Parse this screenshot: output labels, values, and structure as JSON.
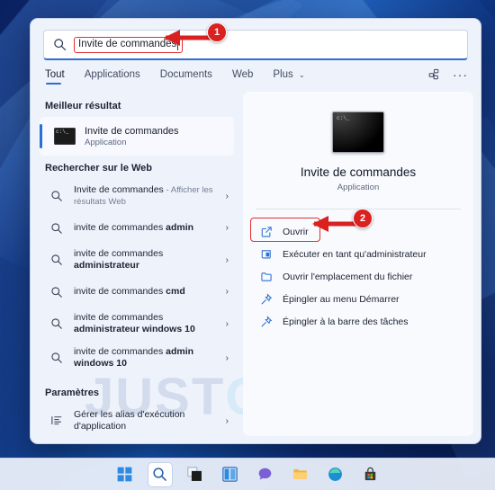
{
  "search": {
    "query": "Invite de commandes",
    "icon": "search-icon"
  },
  "tabs": [
    {
      "label": "Tout",
      "active": true
    },
    {
      "label": "Applications",
      "active": false
    },
    {
      "label": "Documents",
      "active": false
    },
    {
      "label": "Web",
      "active": false
    },
    {
      "label": "Plus",
      "active": false,
      "chevron": "⌄"
    }
  ],
  "tabs_right": {
    "share_icon": "share-nodes-icon",
    "more_icon": "more-options-icon",
    "more_glyph": "···"
  },
  "left": {
    "best_section_title": "Meilleur résultat",
    "best_result": {
      "title": "Invite de commandes",
      "subtitle": "Application",
      "icon_text": "c:\\_"
    },
    "web_section_title": "Rechercher sur le Web",
    "web_results": [
      {
        "main": "Invite de commandes",
        "suffix": " - Afficher les résultats Web",
        "bold": "",
        "two_line": true
      },
      {
        "main": "invite de commandes ",
        "bold": "admin",
        "suffix": "",
        "two_line": false
      },
      {
        "main": "invite de commandes ",
        "bold": "administrateur",
        "suffix": "",
        "two_line": true
      },
      {
        "main": "invite de commandes ",
        "bold": "cmd",
        "suffix": "",
        "two_line": false
      },
      {
        "main": "invite de commandes ",
        "bold": "administrateur windows 10",
        "suffix": "",
        "two_line": true
      },
      {
        "main": "invite de commandes ",
        "bold": "admin windows 10",
        "suffix": "",
        "two_line": true
      }
    ],
    "settings_section_title": "Paramètres",
    "settings_items": [
      {
        "label": "Gérer les alias d'exécution d'application",
        "icon": "settings-list-icon"
      }
    ],
    "chevron_glyph": "›"
  },
  "preview": {
    "title": "Invite de commandes",
    "subtitle": "Application",
    "icon_text": "c:\\_",
    "actions": [
      {
        "label": "Ouvrir",
        "icon": "open-external-icon",
        "highlighted": true
      },
      {
        "label": "Exécuter en tant qu'administrateur",
        "icon": "shield-admin-icon",
        "highlighted": false
      },
      {
        "label": "Ouvrir l'emplacement du fichier",
        "icon": "folder-icon",
        "highlighted": false
      },
      {
        "label": "Épingler au menu Démarrer",
        "icon": "pin-icon",
        "highlighted": false
      },
      {
        "label": "Épingler à la barre des tâches",
        "icon": "pin-icon",
        "highlighted": false
      }
    ]
  },
  "watermark": {
    "part1": "JUST",
    "part2": "GEEK"
  },
  "annotations": [
    {
      "number": "1",
      "color": "#d92121"
    },
    {
      "number": "2",
      "color": "#d92121"
    }
  ],
  "taskbar": {
    "items": [
      {
        "name": "start-icon",
        "active": false
      },
      {
        "name": "search-icon",
        "active": true
      },
      {
        "name": "task-view-icon",
        "active": false
      },
      {
        "name": "widgets-icon",
        "active": false
      },
      {
        "name": "chat-icon",
        "active": false
      },
      {
        "name": "file-explorer-icon",
        "active": false
      },
      {
        "name": "edge-icon",
        "active": false
      },
      {
        "name": "microsoft-store-icon",
        "active": false
      }
    ]
  },
  "colors": {
    "accent": "#2a6fd4",
    "annotation_red": "#d92121",
    "panel_bg": "#eef2fb"
  }
}
